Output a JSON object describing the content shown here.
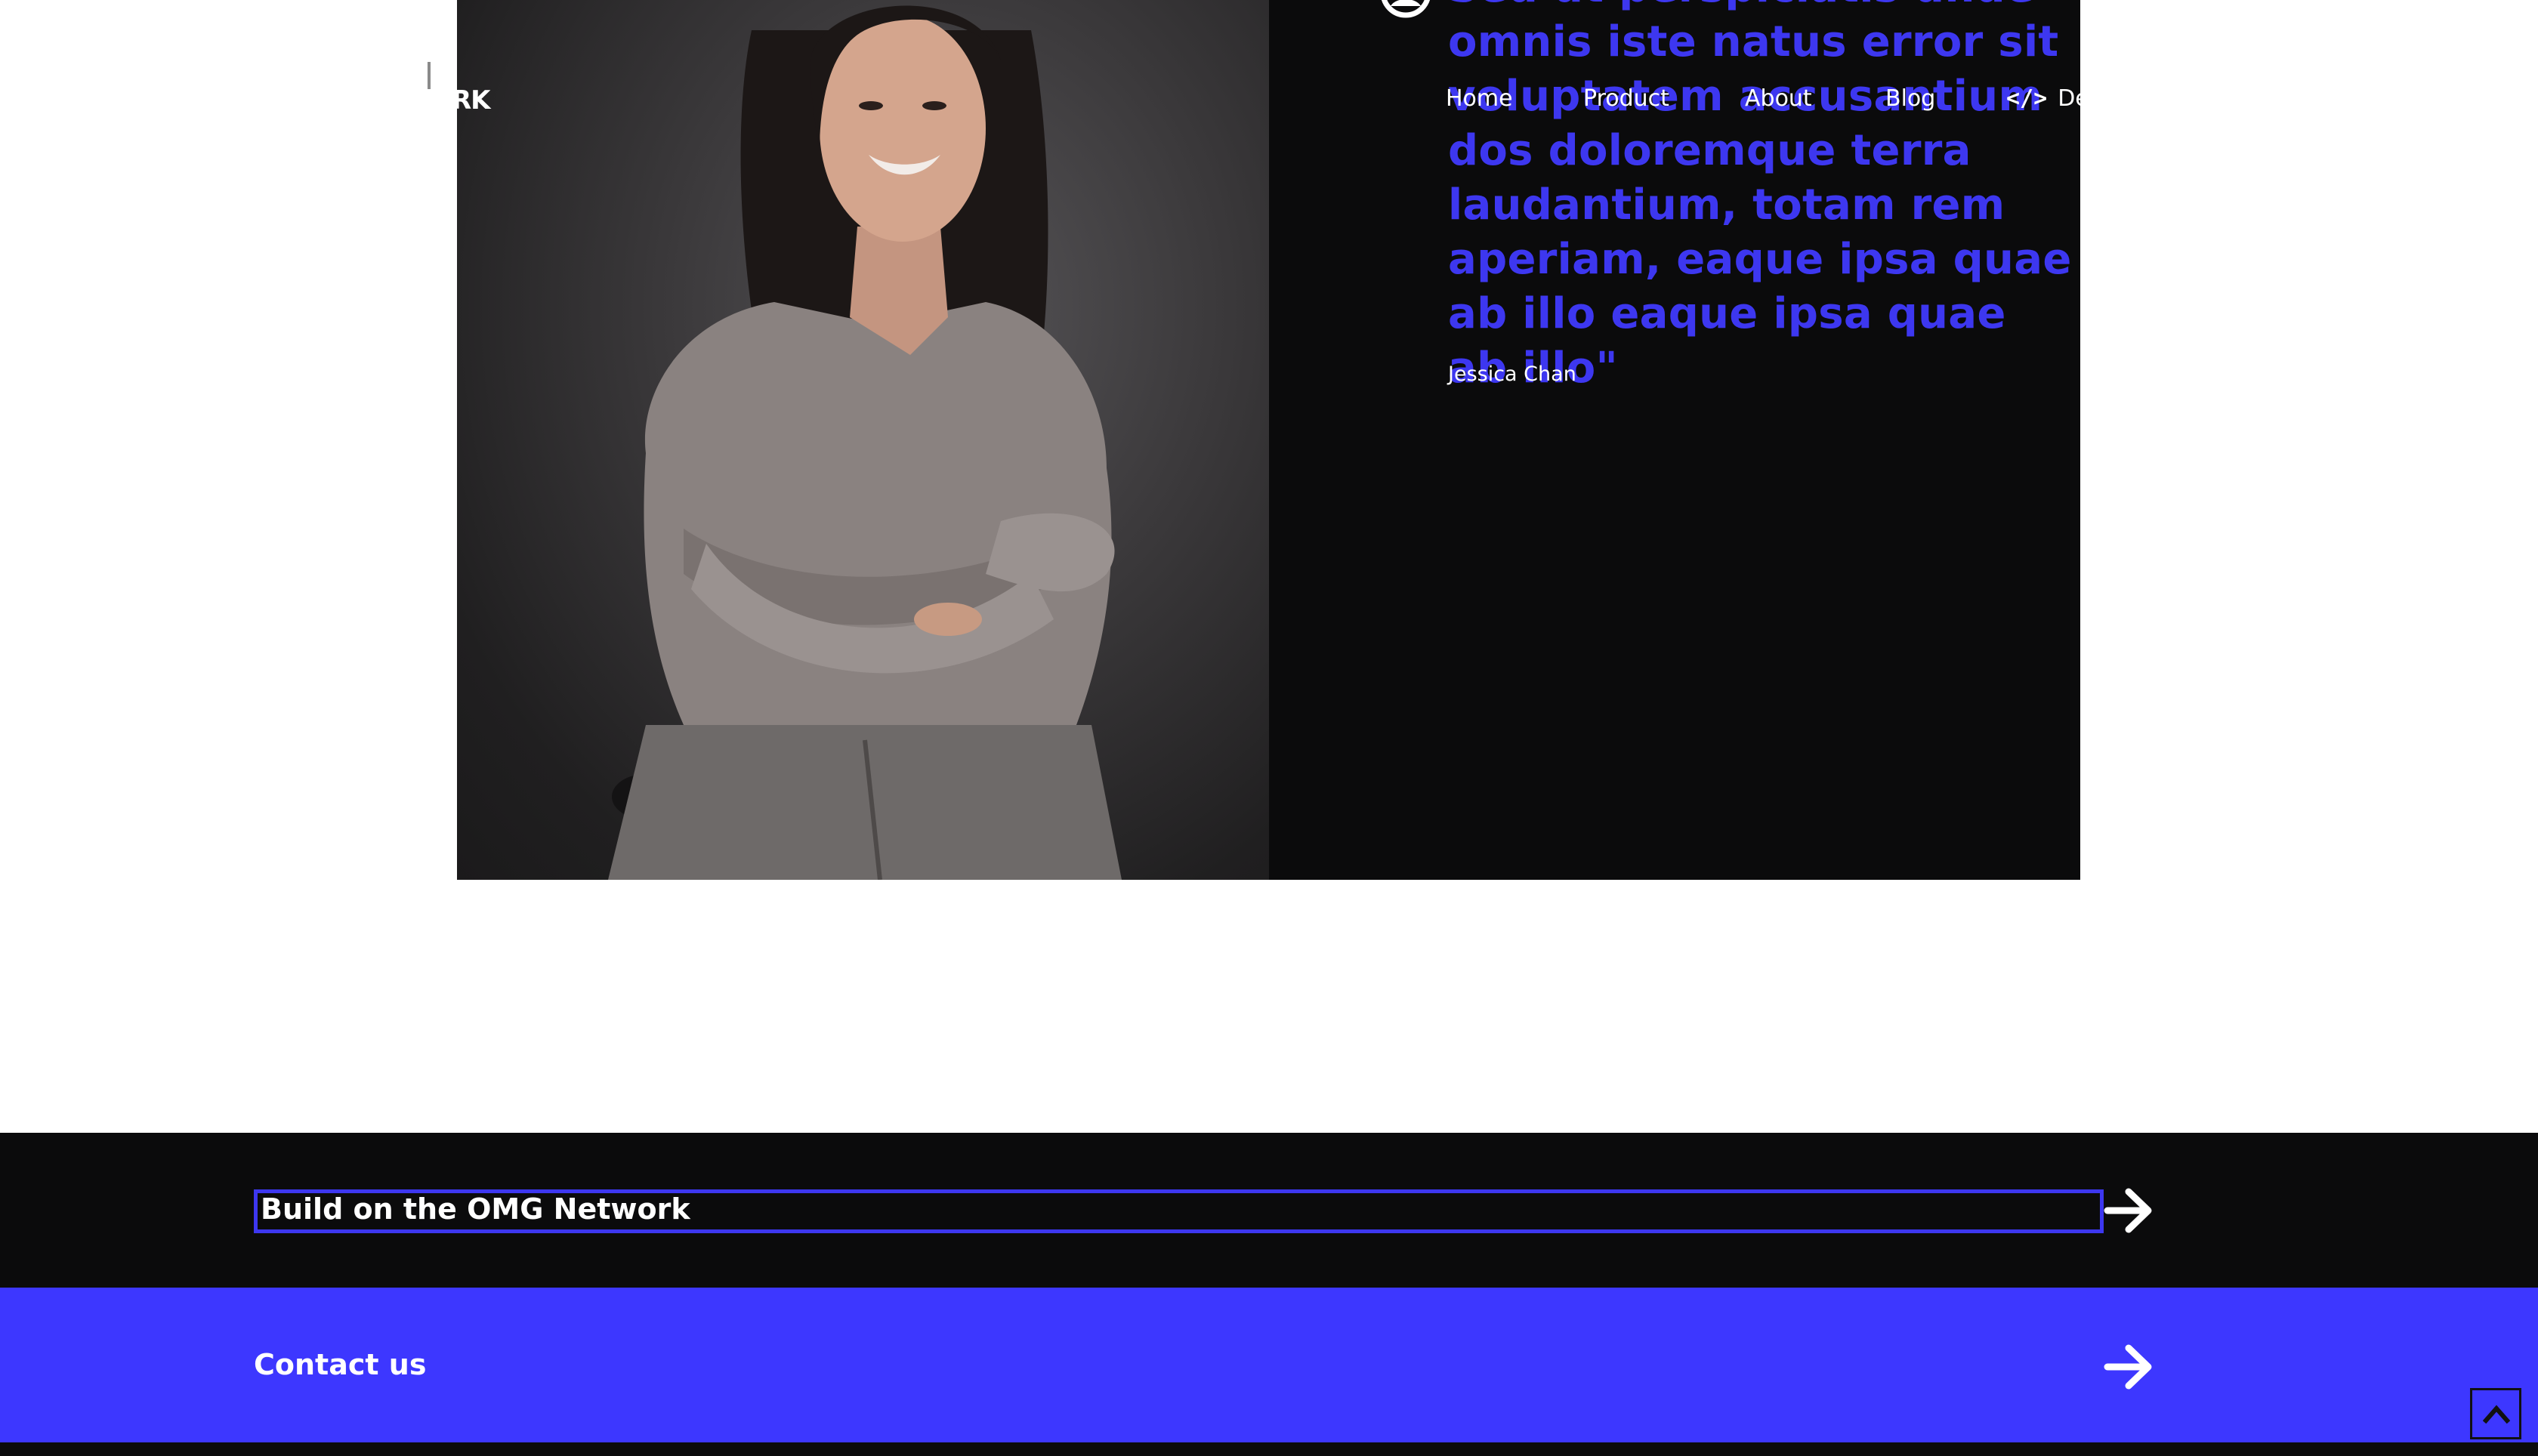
{
  "header": {
    "brand_fragment": "RK",
    "nav": [
      {
        "label": "Home"
      },
      {
        "label": "Product"
      },
      {
        "label": "About"
      },
      {
        "label": "Blog"
      }
    ],
    "dev_link_fragment": "De",
    "dev_icon_glyph": "</>"
  },
  "testimonial": {
    "quote": "Sed ut perspiciatis unde omnis iste natus error sit voluptatem accusantium dos doloremque terra laudantium, totam rem aperiam, eaque ipsa quae ab illo eaque ipsa quae ab illo\"",
    "author": "Jessica Chan"
  },
  "cta": {
    "build": {
      "label": "Build on the OMG Network"
    },
    "contact": {
      "label": "Contact us"
    }
  },
  "colors": {
    "accent": "#3d37ff",
    "dark": "#0b0b0c",
    "text_light": "#ffffff"
  },
  "icons": {
    "quote": "user-circle-icon",
    "arrow": "arrow-right-icon",
    "scroll_top": "chevron-up-icon",
    "code": "code-icon"
  }
}
